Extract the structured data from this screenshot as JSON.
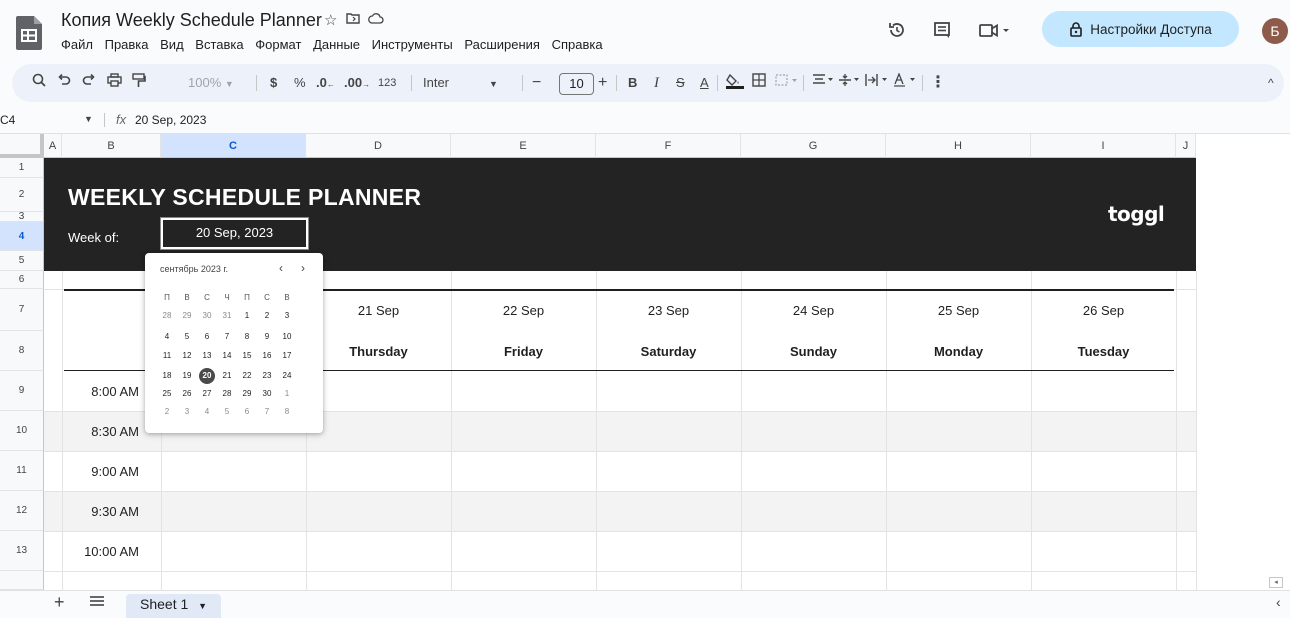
{
  "header": {
    "title": "Копия Weekly Schedule Planner",
    "menu": [
      "Файл",
      "Правка",
      "Вид",
      "Вставка",
      "Формат",
      "Данные",
      "Инструменты",
      "Расширения",
      "Справка"
    ],
    "share_label": "Настройки Доступа",
    "avatar_letter": "Б"
  },
  "toolbar": {
    "zoom": "100%",
    "currency": "$",
    "percent": "%",
    "dec_decrease": ".0",
    "dec_increase": ".00",
    "number_format": "123",
    "font": "Inter",
    "font_size": "10",
    "bold": "B",
    "italic": "I"
  },
  "formula_bar": {
    "cell_ref": "C4",
    "fx": "fx",
    "value": "20 Sep, 2023"
  },
  "columns": [
    "A",
    "B",
    "C",
    "D",
    "E",
    "F",
    "G",
    "H",
    "I",
    "J"
  ],
  "rows": [
    "1",
    "2",
    "3",
    "4",
    "5",
    "6",
    "7",
    "8",
    "9",
    "10",
    "11",
    "12",
    "13"
  ],
  "sheet": {
    "banner_title": "WEEKLY SCHEDULE PLANNER",
    "week_of_label": "Week of:",
    "week_of_value": "20 Sep, 2023",
    "logo": "toggl",
    "dates": [
      "21 Sep",
      "22 Sep",
      "23 Sep",
      "24 Sep",
      "25 Sep",
      "26 Sep"
    ],
    "days": [
      "Thursday",
      "Friday",
      "Saturday",
      "Sunday",
      "Monday",
      "Tuesday"
    ],
    "times": [
      "8:00 AM",
      "8:30 AM",
      "9:00 AM",
      "9:30 AM",
      "10:00 AM"
    ]
  },
  "date_picker": {
    "month_label": "сентябрь 2023 г.",
    "weekdays": [
      "П",
      "В",
      "С",
      "Ч",
      "П",
      "С",
      "В"
    ],
    "weeks": [
      [
        "28",
        "29",
        "30",
        "31",
        "1",
        "2",
        "3"
      ],
      [
        "4",
        "5",
        "6",
        "7",
        "8",
        "9",
        "10"
      ],
      [
        "11",
        "12",
        "13",
        "14",
        "15",
        "16",
        "17"
      ],
      [
        "18",
        "19",
        "20",
        "21",
        "22",
        "23",
        "24"
      ],
      [
        "25",
        "26",
        "27",
        "28",
        "29",
        "30",
        "1"
      ],
      [
        "2",
        "3",
        "4",
        "5",
        "6",
        "7",
        "8"
      ]
    ],
    "selected": "20"
  },
  "bottom": {
    "sheet_tab": "Sheet 1"
  },
  "colors": {
    "banner": "#232323",
    "share_button": "#c2e7ff",
    "selected_header": "#d3e3fd",
    "toolbar": "#edf2fa"
  }
}
